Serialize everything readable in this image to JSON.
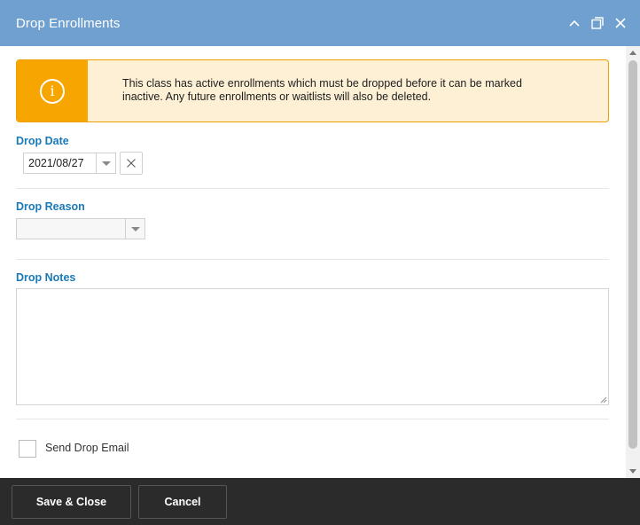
{
  "window": {
    "title": "Drop Enrollments",
    "controls": {
      "collapse_icon": "chevron-up-icon",
      "maximize_icon": "maximize-icon",
      "close_icon": "close-icon"
    }
  },
  "alert": {
    "icon": "info-icon",
    "icon_glyph": "i",
    "message": "This class has active enrollments which must be dropped before it can be marked inactive. Any future enrollments or waitlists will also be deleted.",
    "colors": {
      "accent": "#f7a500",
      "background": "#fdf0d5"
    }
  },
  "drop_date": {
    "label": "Drop Date",
    "value": "2021/08/27"
  },
  "drop_reason": {
    "label": "Drop Reason",
    "value": ""
  },
  "drop_notes": {
    "label": "Drop Notes",
    "value": ""
  },
  "send_email": {
    "label": "Send Drop Email",
    "checked": false
  },
  "footer": {
    "save_label": "Save & Close",
    "cancel_label": "Cancel"
  },
  "colors": {
    "titlebar": "#6fa0cf",
    "label": "#1a7ab8",
    "footer": "#2b2b2b"
  }
}
